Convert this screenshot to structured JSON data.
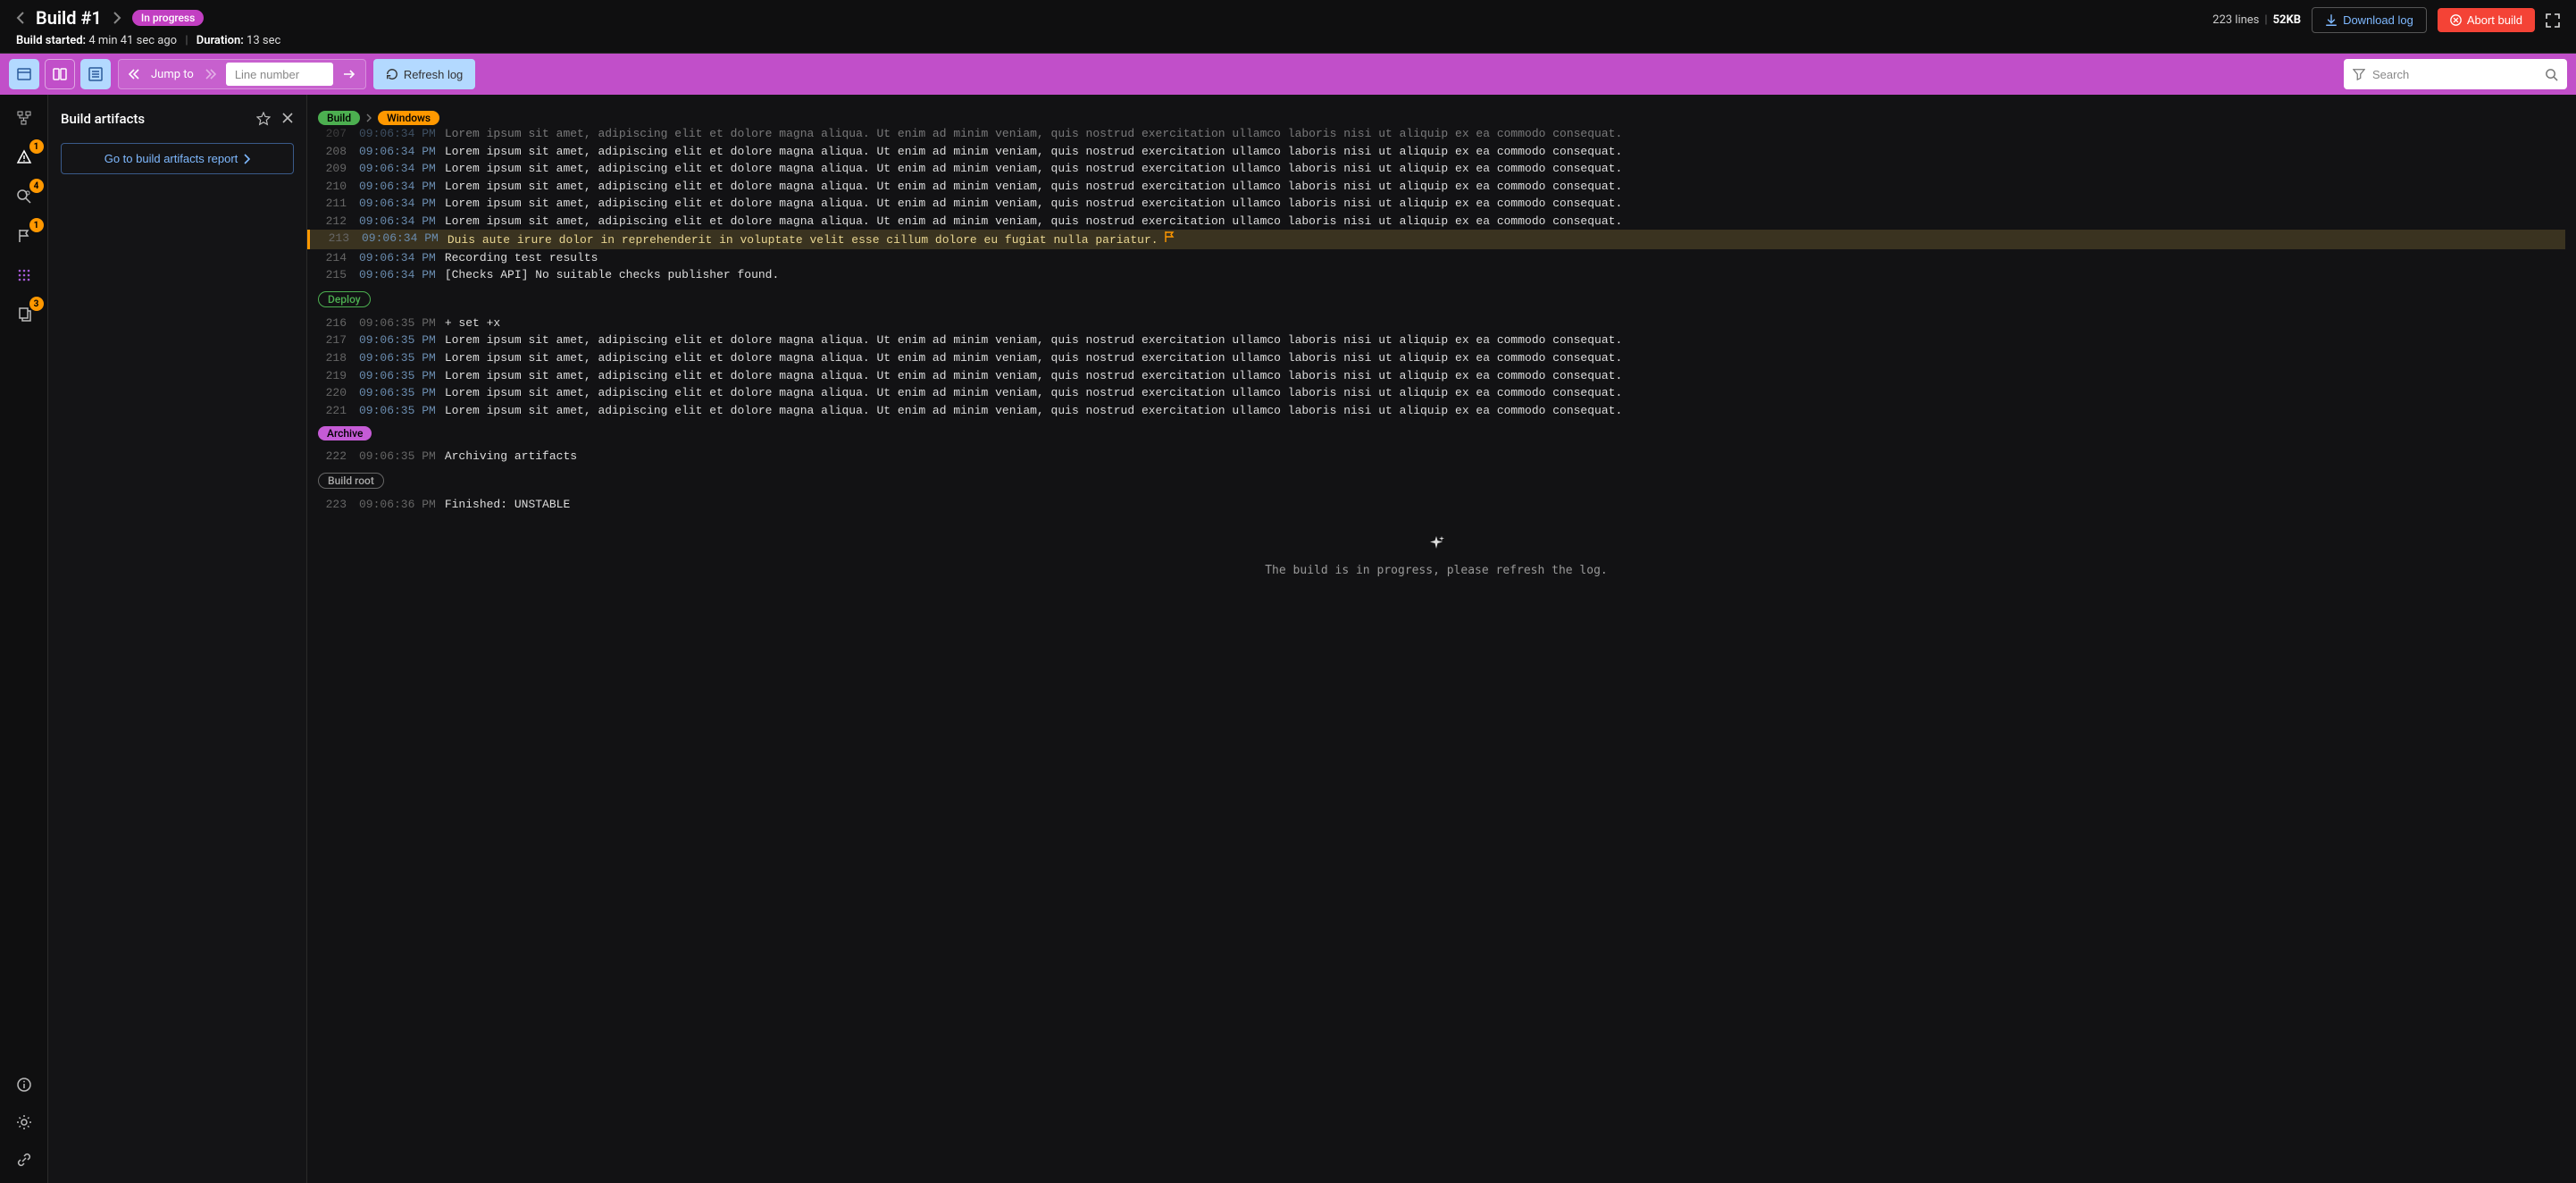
{
  "header": {
    "title": "Build #1",
    "status_badge": "In progress",
    "started_label": "Build started:",
    "started_value": "4 min 41 sec ago",
    "duration_label": "Duration:",
    "duration_value": "13 sec",
    "lines_count": "223 lines",
    "size": "52KB",
    "download_label": "Download log",
    "abort_label": "Abort build"
  },
  "toolbar": {
    "jump_label": "Jump to",
    "line_placeholder": "Line number",
    "refresh_label": "Refresh log",
    "search_placeholder": "Search"
  },
  "rail": {
    "badge_warn": "1",
    "badge_search": "4",
    "badge_flag": "1",
    "badge_copy": "3"
  },
  "panel": {
    "title": "Build artifacts",
    "report_btn": "Go to build artifacts report"
  },
  "sections": [
    {
      "type": "crumbs",
      "items": [
        {
          "text": "Build",
          "cls": "pill-green"
        },
        {
          "text": "Windows",
          "cls": "pill-orange"
        }
      ],
      "sep": true
    },
    {
      "type": "lines",
      "cut_top": true,
      "lines": [
        {
          "n": "207",
          "t": "09:06:34 PM",
          "txt": "Lorem ipsum sit amet, adipiscing elit et dolore magna aliqua. Ut enim ad minim veniam, quis nostrud exercitation ullamco laboris nisi ut aliquip ex ea commodo consequat.",
          "dim": true
        },
        {
          "n": "208",
          "t": "09:06:34 PM",
          "txt": "Lorem ipsum sit amet, adipiscing elit et dolore magna aliqua. Ut enim ad minim veniam, quis nostrud exercitation ullamco laboris nisi ut aliquip ex ea commodo consequat."
        },
        {
          "n": "209",
          "t": "09:06:34 PM",
          "txt": "Lorem ipsum sit amet, adipiscing elit et dolore magna aliqua. Ut enim ad minim veniam, quis nostrud exercitation ullamco laboris nisi ut aliquip ex ea commodo consequat."
        },
        {
          "n": "210",
          "t": "09:06:34 PM",
          "txt": "Lorem ipsum sit amet, adipiscing elit et dolore magna aliqua. Ut enim ad minim veniam, quis nostrud exercitation ullamco laboris nisi ut aliquip ex ea commodo consequat."
        },
        {
          "n": "211",
          "t": "09:06:34 PM",
          "txt": "Lorem ipsum sit amet, adipiscing elit et dolore magna aliqua. Ut enim ad minim veniam, quis nostrud exercitation ullamco laboris nisi ut aliquip ex ea commodo consequat."
        },
        {
          "n": "212",
          "t": "09:06:34 PM",
          "txt": "Lorem ipsum sit amet, adipiscing elit et dolore magna aliqua. Ut enim ad minim veniam, quis nostrud exercitation ullamco laboris nisi ut aliquip ex ea commodo consequat."
        },
        {
          "n": "213",
          "t": "09:06:34 PM",
          "txt": "Duis aute irure dolor in reprehenderit in voluptate velit esse cillum dolore eu fugiat nulla pariatur.",
          "hl": true,
          "flag": true
        },
        {
          "n": "214",
          "t": "09:06:34 PM",
          "txt": "Recording test results",
          "marked": true
        },
        {
          "n": "215",
          "t": "09:06:34 PM",
          "txt": "[Checks API] No suitable checks publisher found.",
          "marked": true
        }
      ]
    },
    {
      "type": "crumbs",
      "items": [
        {
          "text": "Deploy",
          "cls": "pill-green-outline"
        }
      ]
    },
    {
      "type": "lines",
      "lines": [
        {
          "n": "216",
          "t": "09:06:35 PM",
          "txt": "+ set +x",
          "tplain": true
        },
        {
          "n": "217",
          "t": "09:06:35 PM",
          "txt": "Lorem ipsum sit amet, adipiscing elit et dolore magna aliqua. Ut enim ad minim veniam, quis nostrud exercitation ullamco laboris nisi ut aliquip ex ea commodo consequat."
        },
        {
          "n": "218",
          "t": "09:06:35 PM",
          "txt": "Lorem ipsum sit amet, adipiscing elit et dolore magna aliqua. Ut enim ad minim veniam, quis nostrud exercitation ullamco laboris nisi ut aliquip ex ea commodo consequat."
        },
        {
          "n": "219",
          "t": "09:06:35 PM",
          "txt": "Lorem ipsum sit amet, adipiscing elit et dolore magna aliqua. Ut enim ad minim veniam, quis nostrud exercitation ullamco laboris nisi ut aliquip ex ea commodo consequat."
        },
        {
          "n": "220",
          "t": "09:06:35 PM",
          "txt": "Lorem ipsum sit amet, adipiscing elit et dolore magna aliqua. Ut enim ad minim veniam, quis nostrud exercitation ullamco laboris nisi ut aliquip ex ea commodo consequat."
        },
        {
          "n": "221",
          "t": "09:06:35 PM",
          "txt": "Lorem ipsum sit amet, adipiscing elit et dolore magna aliqua. Ut enim ad minim veniam, quis nostrud exercitation ullamco laboris nisi ut aliquip ex ea commodo consequat."
        }
      ]
    },
    {
      "type": "crumbs",
      "items": [
        {
          "text": "Archive",
          "cls": "pill-purple2"
        }
      ]
    },
    {
      "type": "lines",
      "lines": [
        {
          "n": "222",
          "t": "09:06:35 PM",
          "txt": "Archiving artifacts",
          "tplain": true
        }
      ]
    },
    {
      "type": "crumbs",
      "items": [
        {
          "text": "Build root",
          "cls": "pill-grey-outline"
        }
      ]
    },
    {
      "type": "lines",
      "lines": [
        {
          "n": "223",
          "t": "09:06:36 PM",
          "txt": "Finished: UNSTABLE",
          "tplain": true
        }
      ]
    }
  ],
  "footer_msg": "The build is in progress, please refresh the log."
}
